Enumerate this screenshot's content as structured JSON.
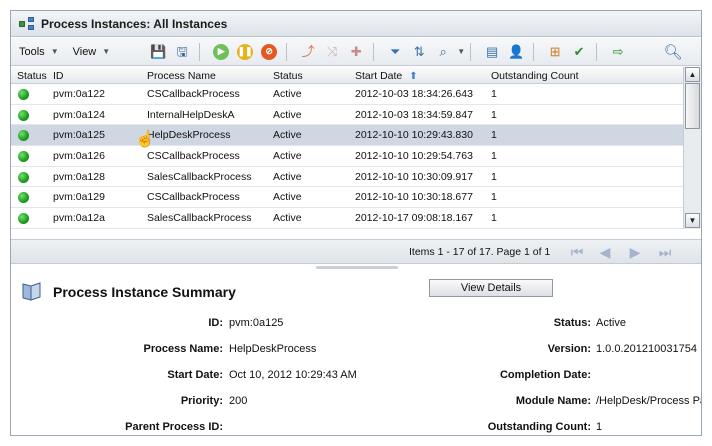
{
  "window": {
    "title": "Process Instances: All Instances"
  },
  "toolbar": {
    "tools_label": "Tools",
    "view_label": "View"
  },
  "icons": {
    "title": "process-tree-icon",
    "save": "save-icon",
    "save_as": "save-as-icon",
    "resume": "resume-icon",
    "suspend": "suspend-icon",
    "terminate": "terminate-icon",
    "restart": "restart-icon",
    "migrate": "migrate-icon",
    "action": "action-icon",
    "filter": "filter-icon",
    "sort": "sort-icon",
    "zoom": "zoom-icon",
    "details": "details-icon",
    "user": "user-icon",
    "hierarchy": "hierarchy-icon",
    "approve": "approve-icon",
    "export": "export-icon",
    "search": "search-icon"
  },
  "table": {
    "headers": {
      "status": "Status",
      "id": "ID",
      "process_name": "Process Name",
      "state": "Status",
      "start_date": "Start Date",
      "outstanding": "Outstanding Count"
    },
    "rows": [
      {
        "id": "pvm:0a122",
        "process_name": "CSCallbackProcess",
        "state": "Active",
        "start_date": "2012-10-03 18:34:26.643",
        "outstanding": "1"
      },
      {
        "id": "pvm:0a124",
        "process_name": "InternalHelpDeskA",
        "state": "Active",
        "start_date": "2012-10-03 18:34:59.847",
        "outstanding": "1"
      },
      {
        "id": "pvm:0a125",
        "process_name": "HelpDeskProcess",
        "state": "Active",
        "start_date": "2012-10-10 10:29:43.830",
        "outstanding": "1"
      },
      {
        "id": "pvm:0a126",
        "process_name": "CSCallbackProcess",
        "state": "Active",
        "start_date": "2012-10-10 10:29:54.763",
        "outstanding": "1"
      },
      {
        "id": "pvm:0a128",
        "process_name": "SalesCallbackProcess",
        "state": "Active",
        "start_date": "2012-10-10 10:30:09.917",
        "outstanding": "1"
      },
      {
        "id": "pvm:0a129",
        "process_name": "CSCallbackProcess",
        "state": "Active",
        "start_date": "2012-10-10 10:30:18.677",
        "outstanding": "1"
      },
      {
        "id": "pvm:0a12a",
        "process_name": "SalesCallbackProcess",
        "state": "Active",
        "start_date": "2012-10-17 09:08:18.167",
        "outstanding": "1"
      }
    ]
  },
  "pager": {
    "info": "Items 1 - 17 of 17. Page 1 of 1"
  },
  "summary": {
    "title": "Process Instance Summary",
    "view_details": "View Details",
    "labels": {
      "id": "ID:",
      "process_name": "Process Name:",
      "start_date": "Start Date:",
      "priority": "Priority:",
      "parent": "Parent Process ID:",
      "status": "Status:",
      "version": "Version:",
      "completion": "Completion Date:",
      "module": "Module Name:",
      "outstanding": "Outstanding Count:"
    },
    "values": {
      "id": "pvm:0a125",
      "process_name": "HelpDeskProcess",
      "start_date": "Oct 10, 2012 10:29:43 AM",
      "priority": "200",
      "parent": "",
      "status": "Active",
      "version": "1.0.0.201210031754",
      "completion": "",
      "module": "/HelpDesk/Process Pa",
      "outstanding": "1"
    }
  },
  "colors": {
    "selected_row": "#cfd7e3",
    "status_active": "#1d9a1d",
    "accent": "#3a6ea5"
  }
}
